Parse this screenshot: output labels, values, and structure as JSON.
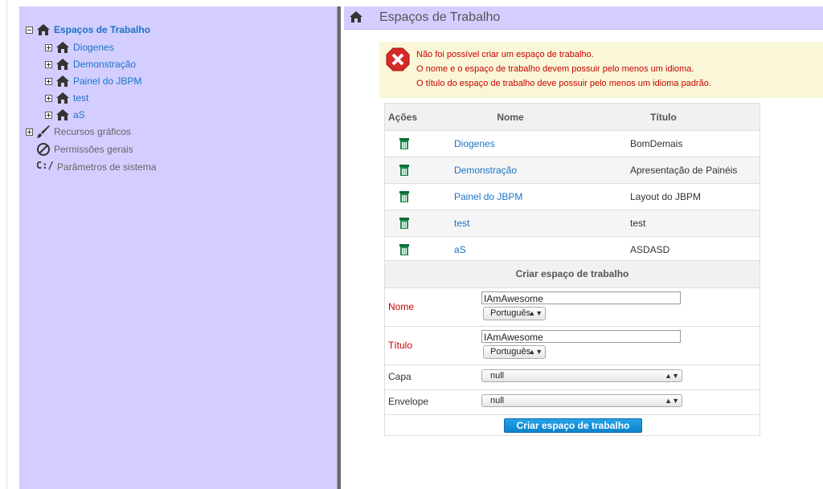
{
  "sidebar": {
    "root": {
      "label": "Espaços de Trabalho"
    },
    "workspaces": [
      {
        "label": "Diogenes"
      },
      {
        "label": "Demonstração"
      },
      {
        "label": "Painel do JBPM"
      },
      {
        "label": "test"
      },
      {
        "label": "aS"
      }
    ],
    "sections": [
      {
        "label": "Recursos gráficos",
        "icon": "brush-icon"
      },
      {
        "label": "Permissões gerais",
        "icon": "prohibited-icon"
      },
      {
        "label": "Parâmetros de sistema",
        "icon": "console-icon",
        "glyph": "C:/"
      }
    ]
  },
  "header": {
    "title": "Espaços de Trabalho"
  },
  "alert": {
    "messages": [
      "Não foi possível criar um espaço de trabalho.",
      "O nome e o espaço de trabalho devem possuir pelo menos um idioma.",
      "O título do espaço de trabalho deve possuir pelo menos um idioma padrão."
    ]
  },
  "table": {
    "headers": {
      "actions": "Ações",
      "name": "Nome",
      "title": "Título"
    },
    "rows": [
      {
        "name": "Diogenes",
        "title": "BomDemais"
      },
      {
        "name": "Demonstração",
        "title": "Apresentação de Painéis"
      },
      {
        "name": "Painel do JBPM",
        "title": "Layout do JBPM"
      },
      {
        "name": "test",
        "title": "test"
      },
      {
        "name": "aS",
        "title": "ASDASD"
      }
    ]
  },
  "form": {
    "heading": "Criar espaço de trabalho",
    "name_label": "Nome",
    "name_value": "IAmAwesome",
    "name_lang": "Português",
    "title_label": "Título",
    "title_value": "IAmAwesome",
    "title_lang": "Português",
    "skin_label": "Capa",
    "skin_value": "null",
    "envelope_label": "Envelope",
    "envelope_value": "null",
    "submit_label": "Criar espaço de trabalho"
  },
  "colors": {
    "sidebar_bg": "#d3ceff",
    "link": "#1a73c6",
    "error": "#cc0000",
    "button": "#0d84cd"
  }
}
